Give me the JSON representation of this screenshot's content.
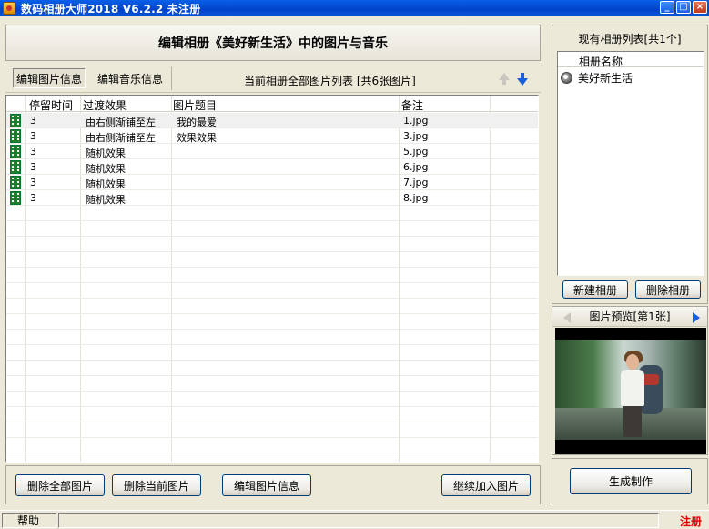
{
  "window": {
    "title": "数码相册大师2018 V6.2.2  未注册",
    "minimize": "_",
    "maximize": "□",
    "close": "×"
  },
  "main": {
    "header": "编辑相册《美好新生活》中的图片与音乐",
    "tabs": [
      {
        "label": "编辑图片信息",
        "active": true
      },
      {
        "label": "编辑音乐信息",
        "active": false
      }
    ],
    "list_title": "当前相册全部图片列表 [共6张图片]",
    "move_up": "上移",
    "move_down": "下移"
  },
  "grid": {
    "columns": [
      "停留时间",
      "过渡效果",
      "图片题目",
      "备注"
    ],
    "rows": [
      {
        "duration": "3",
        "transition": "由右侧渐铺至左",
        "title": "我的最爱",
        "note": "1.jpg",
        "selected": true
      },
      {
        "duration": "3",
        "transition": "由右侧渐铺至左",
        "title": "效果效果",
        "note": "3.jpg",
        "selected": false
      },
      {
        "duration": "3",
        "transition": "随机效果",
        "title": "",
        "note": "5.jpg",
        "selected": false
      },
      {
        "duration": "3",
        "transition": "随机效果",
        "title": "",
        "note": "6.jpg",
        "selected": false
      },
      {
        "duration": "3",
        "transition": "随机效果",
        "title": "",
        "note": "7.jpg",
        "selected": false
      },
      {
        "duration": "3",
        "transition": "随机效果",
        "title": "",
        "note": "8.jpg",
        "selected": false
      }
    ]
  },
  "bottom_buttons": {
    "delete_all": "删除全部图片",
    "delete_current": "删除当前图片",
    "edit_info": "编辑图片信息",
    "continue_add": "继续加入图片"
  },
  "albums": {
    "title": "现有相册列表[共1个]",
    "column": "相册名称",
    "items": [
      "美好新生活"
    ],
    "new_button": "新建相册",
    "delete_button": "删除相册"
  },
  "preview": {
    "title": "图片预览[第1张]"
  },
  "make_button": "生成制作",
  "status": {
    "help": "帮助",
    "register": "注册"
  },
  "colors": {
    "titlebar": "#0a54d6",
    "accent_blue": "#1560d8",
    "register_red": "#e00000"
  }
}
